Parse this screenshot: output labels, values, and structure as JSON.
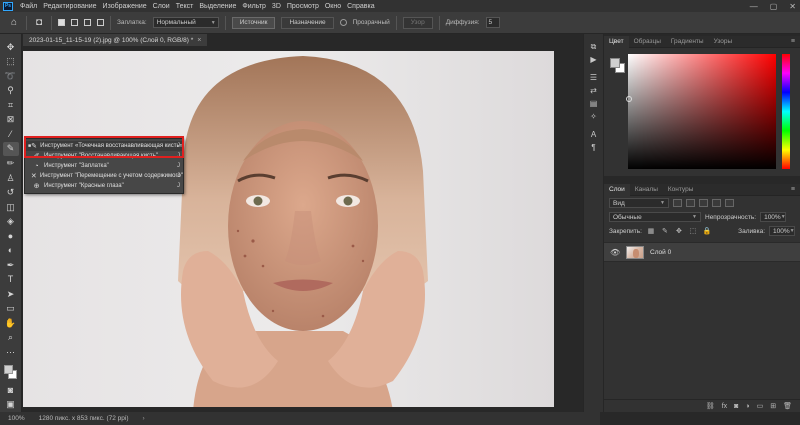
{
  "menu": {
    "logo": "Ps",
    "items": [
      "Файл",
      "Редактирование",
      "Изображение",
      "Слои",
      "Текст",
      "Выделение",
      "Фильтр",
      "3D",
      "Просмотр",
      "Окно",
      "Справка"
    ]
  },
  "window_controls": {
    "minimize": "—",
    "maximize": "▢",
    "close": "✕"
  },
  "options": {
    "patch_label": "Заплатка:",
    "mode_value": "Нормальный",
    "source_label": "Источник",
    "destination_label": "Назначение",
    "transparent_label": "Прозрачный",
    "use_pattern_label": "Узор",
    "diffusion_label": "Диффузия:",
    "diffusion_value": "5"
  },
  "document": {
    "tab_title": "2023-01-15_11-15-19 (2).jpg @ 100% (Слой 0, RGB/8) *",
    "close_glyph": "×"
  },
  "flyout": {
    "items": [
      {
        "label": "Инструмент «Точечная восстанавливающая кисть»",
        "key": "J",
        "icon": "spot-healing-brush-icon",
        "glyph": "✎",
        "active": true
      },
      {
        "label": "Инструмент \"Восстанавливающая кисть\"",
        "key": "J",
        "icon": "healing-brush-icon",
        "glyph": "✐",
        "active": false
      },
      {
        "label": "Инструмент \"Заплатка\"",
        "key": "J",
        "icon": "patch-icon",
        "glyph": "◔",
        "active": false
      },
      {
        "label": "Инструмент \"Перемещение с учетом содержимого\"",
        "key": "J",
        "icon": "content-aware-move-icon",
        "glyph": "✕",
        "active": false
      },
      {
        "label": "Инструмент \"Красные глаза\"",
        "key": "J",
        "icon": "red-eye-icon",
        "glyph": "⊕",
        "active": false
      }
    ]
  },
  "status": {
    "zoom": "100%",
    "doc_info": "1280 пикс. x 853 пикс. (72 ppi)",
    "arrow": "›"
  },
  "color_panel": {
    "tabs": [
      "Цвет",
      "Образцы",
      "Градиенты",
      "Узоры"
    ],
    "active_tab": "Цвет",
    "menu_glyph": "≡",
    "fg_color": "#cfcfcf",
    "bg_color": "#ffffff",
    "hue": "#ff0000"
  },
  "layers_panel": {
    "tabs": [
      "Слои",
      "Каналы",
      "Контуры"
    ],
    "active_tab": "Слои",
    "menu_glyph": "≡",
    "filter_value": "Вид",
    "blend_mode": "Обычные",
    "opacity_label": "Непрозрачность:",
    "opacity_value": "100%",
    "lock_label": "Закрепить:",
    "fill_label": "Заливка:",
    "fill_value": "100%",
    "layer_name": "Слой 0",
    "footer_icons": [
      "link-icon",
      "fx-icon",
      "mask-icon",
      "adjustment-icon",
      "group-icon",
      "new-layer-icon",
      "trash-icon"
    ],
    "footer_glyphs": [
      "⛓",
      "fx",
      "◙",
      "◑",
      "▭",
      "⊞",
      "🗑"
    ]
  }
}
